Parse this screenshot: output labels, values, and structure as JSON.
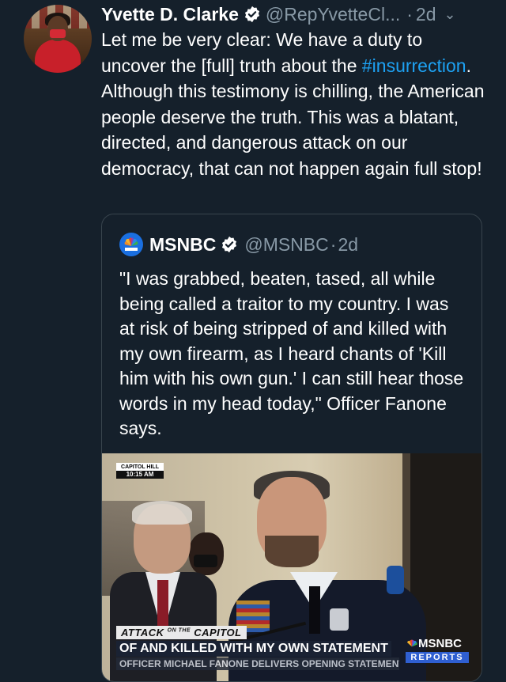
{
  "tweet": {
    "author_name": "Yvette D. Clarke",
    "handle": "@RepYvetteCl...",
    "separator": "·",
    "time": "2d",
    "text_parts": [
      "Let me be very clear:  We have a duty to uncover the [full] truth about the ",
      "#insurrection",
      ". Although this testimony is chilling, the American people deserve the truth. This was a blatant, directed, and dangerous attack on our democracy, that can not happen again full stop!"
    ]
  },
  "quote": {
    "author_name": "MSNBC",
    "handle": "@MSNBC",
    "separator": "·",
    "time": "2d",
    "text": "\"I was grabbed, beaten, tased, all while being called a traitor to my country.  I was at risk of being stripped of and killed with my own firearm, as I heard chants of 'Kill him with his own gun.' I can still hear those words in my head today,\" Officer Fanone says.",
    "video": {
      "location_label": "CAPITOL HILL",
      "time_label": "10:15 AM",
      "tag_left": "ATTACK",
      "tag_on": "ON THE",
      "tag_right": "CAPITOL",
      "caption": "OF AND KILLED WITH MY OWN",
      "caption_sub": "STATEMENT",
      "subline": "OFFICER MICHAEL FANONE DELIVERS OPENING STATEMENT",
      "network": "MSNBC",
      "network_sub": "REPORTS"
    }
  },
  "colors": {
    "background": "#15202b",
    "link": "#1da1f2",
    "muted": "#8899a6",
    "border": "#38444d"
  }
}
